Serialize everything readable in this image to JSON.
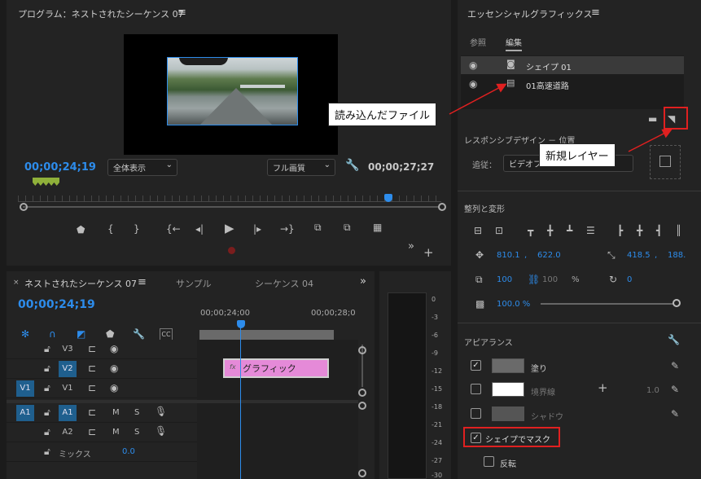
{
  "program": {
    "title": "プログラム：ネストされたシーケンス 07",
    "timecode_current": "00;00;24;19",
    "timecode_duration": "00;00;27;27",
    "fit_select": "全体表示",
    "quality_select": "フル画質"
  },
  "timeline": {
    "tab_active": "ネストされたシーケンス 07",
    "tab_2": "サンプル",
    "tab_3": "シーケンス 04",
    "timecode": "00;00;24;19",
    "ruler_1": "00;00;24;00",
    "ruler_2": "00;00;28;0",
    "tracks": [
      {
        "src": "",
        "name": "V3"
      },
      {
        "src": "",
        "name": "V2"
      },
      {
        "src": "V1",
        "name": "V1"
      },
      {
        "src": "A1",
        "name": "A1"
      },
      {
        "src": "",
        "name": "A2"
      }
    ],
    "mix_label": "ミックス",
    "mix_value": "0.0",
    "mute": "M",
    "solo": "S",
    "clip_label": "グラフィック",
    "fx_badge": "fx"
  },
  "meter": {
    "labels": [
      "0",
      "-3",
      "-6",
      "-9",
      "-12",
      "-15",
      "-18",
      "-21",
      "-24",
      "-27",
      "-30"
    ]
  },
  "eg": {
    "title": "エッセンシャルグラフィックス",
    "tab_browse": "参照",
    "tab_edit": "編集",
    "layers": [
      {
        "name": "シェイプ 01"
      },
      {
        "name": "01高速道路"
      }
    ],
    "responsive_label": "レスポンシブデザイン － 位置",
    "follow_label": "追従：",
    "follow_value": "ビデオフ",
    "align_header": "整列と変形",
    "pos_x": "810.1",
    "pos_y": "622.0",
    "anchor_x": "418.5",
    "anchor_y": "188.",
    "scale": "100",
    "scale_2": "100",
    "percent": "%",
    "rotation": "0",
    "opacity": "100.0 %",
    "appearance_header": "アピアランス",
    "fill_label": "塗り",
    "stroke_label": "境界線",
    "stroke_width": "1.0",
    "shadow_label": "シャドウ",
    "mask_label": "シェイプでマスク",
    "invert_label": "反転"
  },
  "callouts": {
    "imported_file": "読み込んだファイル",
    "new_layer": "新規レイヤー"
  },
  "colors": {
    "accent": "#2d8ceb",
    "callout_red": "#e02020",
    "clip_pink": "#e58ad8"
  }
}
